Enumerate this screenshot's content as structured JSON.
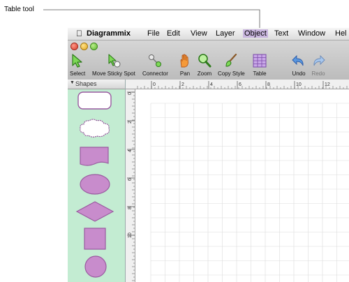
{
  "callout": {
    "label": "Table tool"
  },
  "menubar": {
    "app_name": "Diagrammix",
    "items": [
      "File",
      "Edit",
      "View",
      "Layer",
      "Object",
      "Text",
      "Window",
      "Hel"
    ]
  },
  "toolbar": {
    "tools": [
      {
        "label": "Select",
        "icon": "select-arrow-icon"
      },
      {
        "label": "Move Sticky Spot",
        "icon": "move-sticky-spot-icon"
      },
      {
        "label": "Connector",
        "icon": "connector-icon"
      },
      {
        "label": "Pan",
        "icon": "hand-icon"
      },
      {
        "label": "Zoom",
        "icon": "magnifier-icon"
      },
      {
        "label": "Copy Style",
        "icon": "brush-icon"
      },
      {
        "label": "Table",
        "icon": "table-icon"
      },
      {
        "label": "Undo",
        "icon": "undo-icon"
      },
      {
        "label": "Redo",
        "icon": "redo-icon",
        "disabled": true
      }
    ]
  },
  "shapes_panel": {
    "title": "Shapes",
    "shapes": [
      "rounded-rectangle",
      "cloud",
      "wave-rectangle",
      "ellipse",
      "diamond",
      "square",
      "circle"
    ]
  },
  "ruler": {
    "top_labels": [
      "0",
      "2",
      "4",
      "6",
      "8",
      "10",
      "12"
    ],
    "left_labels": [
      "0",
      "2",
      "4",
      "6",
      "8",
      "10"
    ]
  },
  "colors": {
    "shape_fill": "#c88ccc",
    "shape_stroke": "#9a5aa0",
    "panel_bg": "#c3ecd2",
    "active_menu": "#c9b6de"
  }
}
